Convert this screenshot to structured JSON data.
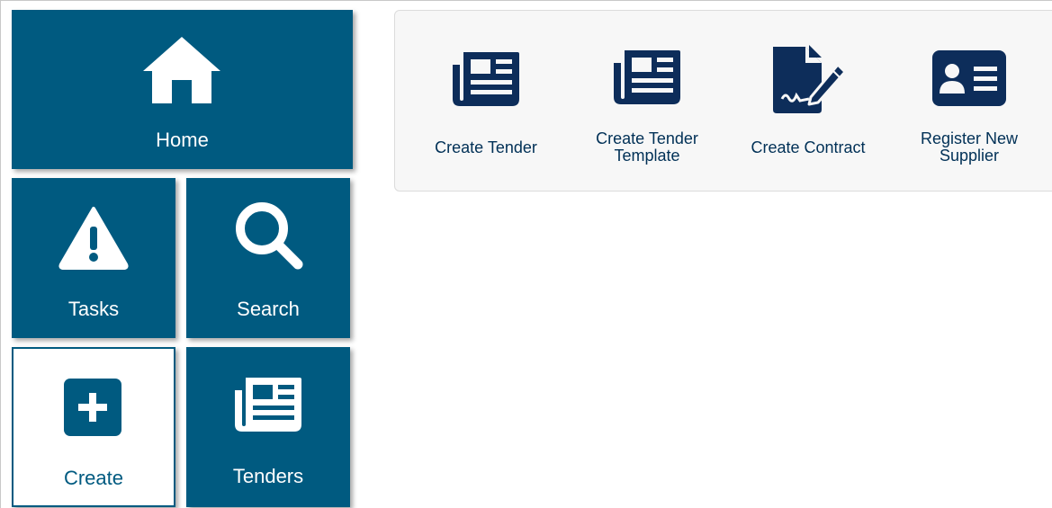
{
  "tiles": {
    "home": "Home",
    "tasks": "Tasks",
    "search": "Search",
    "create": "Create",
    "tenders": "Tenders"
  },
  "create_panel": {
    "actions": [
      {
        "label_line1": "Create Tender",
        "label_line2": "",
        "icon": "newspaper-icon"
      },
      {
        "label_line1": "Create Tender",
        "label_line2": "Template",
        "icon": "newspaper-icon"
      },
      {
        "label_line1": "Create Contract",
        "label_line2": "",
        "icon": "signed-contract-icon"
      },
      {
        "label_line1": "Register New",
        "label_line2": "Supplier",
        "icon": "id-card-icon"
      }
    ]
  },
  "colors": {
    "tile_bg": "#005a80",
    "icon_dark": "#0d2d5a",
    "panel_bg": "#f7f7f7"
  }
}
